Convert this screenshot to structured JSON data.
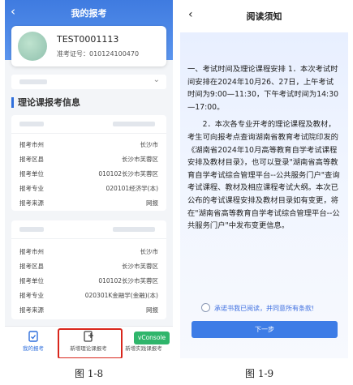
{
  "left_screen": {
    "header": {
      "back": "‹",
      "title": "我的报考"
    },
    "profile": {
      "name": "TEST0001113",
      "zkz": "准考证号：010124100470"
    },
    "dropdown": {
      "chevron": "⌄"
    },
    "section_title": "理论课报考信息",
    "cards": [
      {
        "rows": [
          {
            "k": "报考市州",
            "v": "长沙市"
          },
          {
            "k": "报考区县",
            "v": "长沙市芙蓉区"
          },
          {
            "k": "报考单位",
            "v": "010102长沙市芙蓉区"
          },
          {
            "k": "报考专业",
            "v": "020101经济学(本)"
          },
          {
            "k": "报考来源",
            "v": "网报"
          }
        ]
      },
      {
        "rows": [
          {
            "k": "报考市州",
            "v": "长沙市"
          },
          {
            "k": "报考区县",
            "v": "长沙市芙蓉区"
          },
          {
            "k": "报考单位",
            "v": "010102长沙市芙蓉区"
          },
          {
            "k": "报考专业",
            "v": "020301K金融学(金融)(本)"
          },
          {
            "k": "报考来源",
            "v": "网报"
          }
        ]
      }
    ],
    "tabbar": {
      "tab1": "我的报考",
      "tab2": "新增理论课报考",
      "tab3": "新增实践课报考",
      "vconsole": "vConsole"
    }
  },
  "right_screen": {
    "header": {
      "back": "‹",
      "title": "阅读须知"
    },
    "notice": {
      "p1": "一、考试时间及理论课程安排 1．本次考试时间安排在2024年10月26、27日，上午考试时间为9:00—11:30，下午考试时间为14:30—17:00。",
      "p2": "2．本次各专业开考的理论课程及教材，考生可向报考点查询湖南省教育考试院印发的《湖南省2024年10月高等教育自学考试课程安排及教材目录》，也可以登录\"湖南省高等教育自学考试综合管理平台--公共服务门户\"查询考试课程、教材及相应课程考试大纲。本次已公布的考试课程安排及教材目录如有变更，将在\"湖南省高等教育自学考试综合管理平台--公共服务门户\"中发布变更信息。"
    },
    "agree": "承诺书我已阅读，并同意所有条款!",
    "next_button": "下一步"
  },
  "captions": {
    "left": "图 1-8",
    "right": "图 1-9"
  },
  "colors": {
    "primary": "#3d7ce6",
    "highlight": "#d9261c",
    "vconsole": "#2fb56b"
  }
}
